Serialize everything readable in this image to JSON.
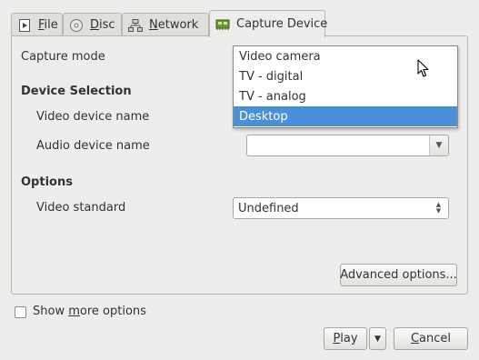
{
  "tabs": [
    {
      "label": "File",
      "underline": "F",
      "rest": "ile",
      "icon": "file-icon"
    },
    {
      "label": "Disc",
      "underline": "D",
      "rest": "isc",
      "icon": "disc-icon"
    },
    {
      "label": "Network",
      "underline": "N",
      "rest": "etwork",
      "icon": "network-icon"
    },
    {
      "label": "Capture Device",
      "underline": "",
      "rest": "Capture Device",
      "icon": "capture-card-icon"
    }
  ],
  "active_tab": "Capture Device",
  "capture": {
    "mode_label": "Capture mode",
    "mode_options": [
      "Video camera",
      "TV - digital",
      "TV - analog",
      "Desktop"
    ],
    "mode_selected": "Desktop"
  },
  "device_selection": {
    "heading": "Device Selection",
    "video_label": "Video device name",
    "audio_label": "Audio device name",
    "audio_value": ""
  },
  "options": {
    "heading": "Options",
    "standard_label": "Video standard",
    "standard_value": "Undefined",
    "advanced_button": "Advanced options..."
  },
  "footer": {
    "show_more_pre": "Show ",
    "show_more_ul": "m",
    "show_more_post": "ore options",
    "play_ul": "P",
    "play_rest": "lay",
    "cancel_ul": "C",
    "cancel_rest": "ancel"
  },
  "colors": {
    "background": "#eeedeb",
    "selection": "#4a90d9"
  }
}
